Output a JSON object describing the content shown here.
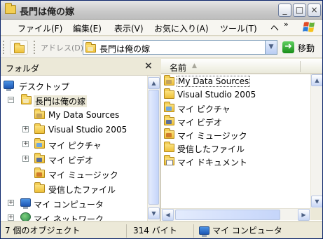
{
  "window": {
    "title": "長門は俺の嫁"
  },
  "menubar": {
    "items": [
      "ファイル(F)",
      "編集(E)",
      "表示(V)",
      "お気に入り(A)",
      "ツール(T)"
    ],
    "more": "ヘ",
    "overflow": "»"
  },
  "address": {
    "label": "アドレス(D)",
    "value": "長門は俺の嫁",
    "go_label": "移動"
  },
  "folderpane": {
    "title": "フォルダ",
    "close": "×",
    "tree": [
      {
        "label": "デスクトップ",
        "icon": "desktop-icon"
      },
      {
        "label": "長門は俺の嫁",
        "icon": "user-folder-icon",
        "expander": "−"
      },
      {
        "label": "My Data Sources",
        "icon": "data-sources-folder-icon"
      },
      {
        "label": "Visual Studio 2005",
        "icon": "folder-icon",
        "expander": "+"
      },
      {
        "label": "マイ ピクチャ",
        "icon": "pictures-folder-icon",
        "expander": "+"
      },
      {
        "label": "マイ ビデオ",
        "icon": "video-folder-icon",
        "expander": "+"
      },
      {
        "label": "マイ ミュージック",
        "icon": "music-folder-icon"
      },
      {
        "label": "受信したファイル",
        "icon": "folder-icon"
      },
      {
        "label": "マイ コンピュータ",
        "icon": "computer-icon",
        "expander": "+"
      },
      {
        "label": "マイ ネットワーク",
        "icon": "network-icon",
        "expander": "+"
      }
    ]
  },
  "filepane": {
    "column_name": "名前",
    "files": [
      {
        "label": "My Data Sources",
        "icon": "data-sources-folder-icon"
      },
      {
        "label": "Visual Studio 2005",
        "icon": "folder-icon"
      },
      {
        "label": "マイ ピクチャ",
        "icon": "pictures-folder-icon"
      },
      {
        "label": "マイ ビデオ",
        "icon": "video-folder-icon"
      },
      {
        "label": "マイ ミュージック",
        "icon": "music-folder-icon"
      },
      {
        "label": "受信したファイル",
        "icon": "folder-icon"
      },
      {
        "label": "マイ ドキュメント",
        "icon": "documents-icon"
      }
    ]
  },
  "statusbar": {
    "objects": "7 個のオブジェクト",
    "size": "314 バイト",
    "location": "マイ コンピュータ"
  }
}
